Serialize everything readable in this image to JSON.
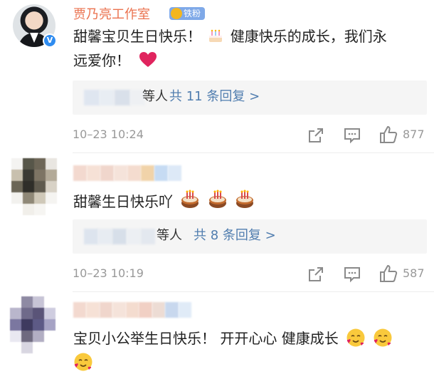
{
  "comment1": {
    "username": "贾乃亮工作室",
    "fan_badge": "铁粉",
    "text_line1": "甜馨宝贝生日快乐！",
    "text_line1b": "健康快乐的成长，我们永",
    "text_line2": "远爱你！",
    "reply_etc": "等人",
    "reply_link": "共 11 条回复 >",
    "time": "10–23 10:24",
    "likes": "877"
  },
  "comment2": {
    "text": "甜馨生日快乐吖",
    "reply_etc": "等人",
    "reply_link": "共 8 条回复 >",
    "time": "10–23 10:19",
    "likes": "587"
  },
  "comment3": {
    "text": "宝贝小公举生日快乐！ 开开心心 健康成长"
  },
  "colors": {
    "username": "#eb7350",
    "link": "#507daf",
    "meta": "#999999",
    "reply_bg": "#f5f5f5",
    "verified": "#2f8cf0"
  },
  "icons": [
    "birthday-cake-icon",
    "red-heart-icon",
    "share-icon",
    "comment-icon",
    "like-icon",
    "smiling-face-with-hearts-icon"
  ]
}
